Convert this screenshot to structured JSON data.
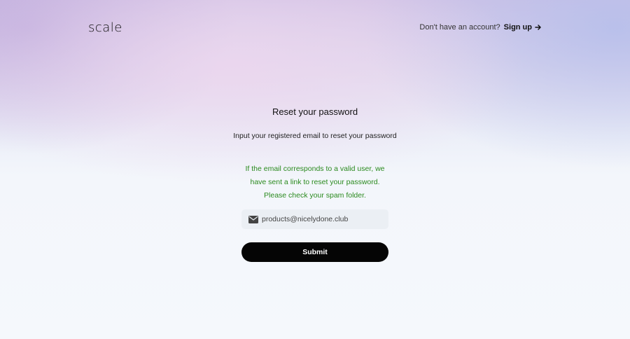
{
  "header": {
    "logo_text": "scale",
    "signup_prompt": "Don't have an account?",
    "signup_label": "Sign up",
    "signup_icon": "arrow-right-icon"
  },
  "reset": {
    "title": "Reset your password",
    "subtitle": "Input your registered email to reset your password",
    "success_lines": [
      "If the email corresponds to a valid user, we",
      "have sent a link to reset your password.",
      "Please check your spam folder."
    ],
    "email_icon": "envelope-icon",
    "email_value": "products@nicelydone.club",
    "submit_label": "Submit"
  },
  "colors": {
    "success_text": "#2a8a1e",
    "button_bg": "#050505",
    "field_bg": "#ebeff4"
  }
}
